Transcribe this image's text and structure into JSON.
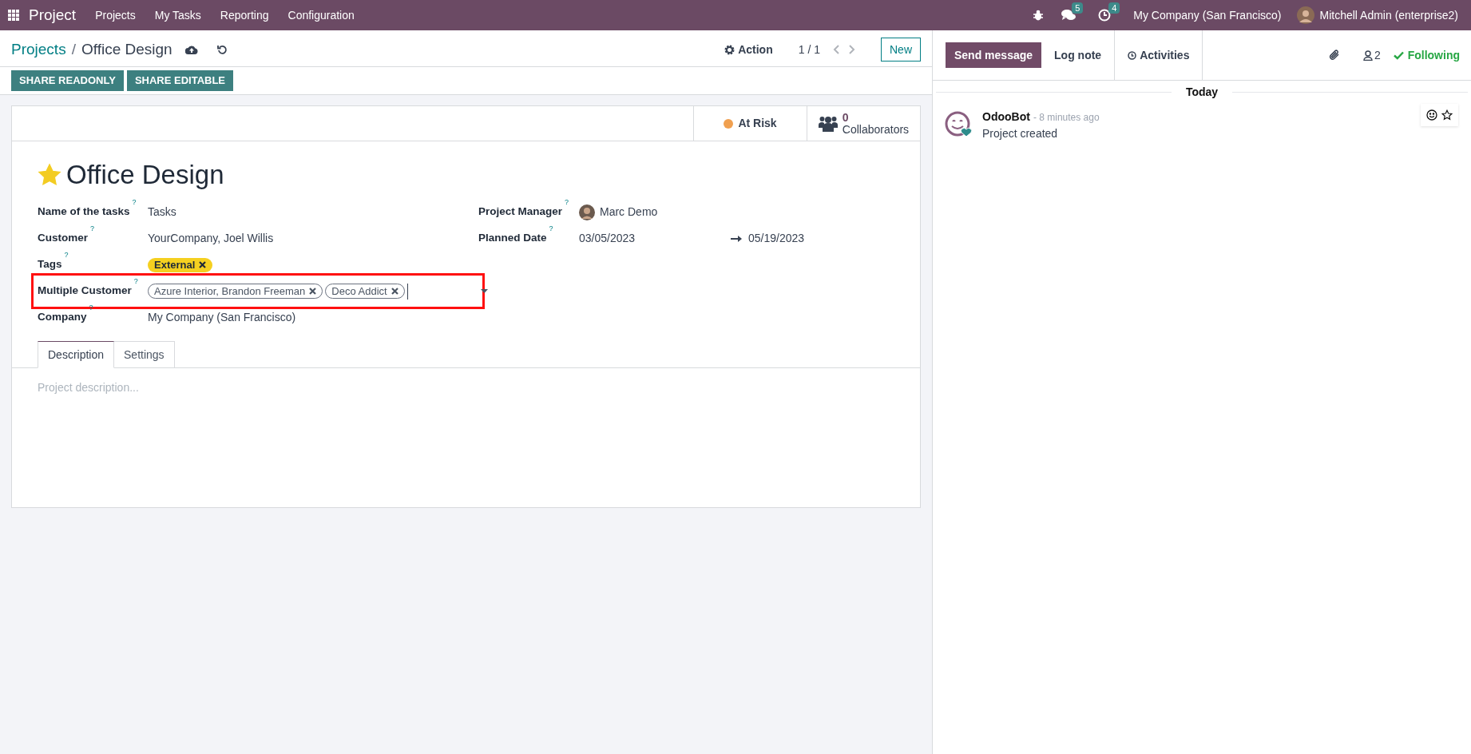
{
  "navbar": {
    "app": "Project",
    "menu": [
      "Projects",
      "My Tasks",
      "Reporting",
      "Configuration"
    ],
    "messages_count": "5",
    "activities_count": "4",
    "company": "My Company (San Francisco)",
    "user": "Mitchell Admin (enterprise2)"
  },
  "breadcrumb": {
    "parent": "Projects",
    "separator": "/",
    "current": "Office Design"
  },
  "help_mark": "?",
  "control": {
    "action": "Action",
    "pager": "1 / 1",
    "new_button": "New"
  },
  "share_buttons": [
    "SHARE READONLY",
    "SHARE EDITABLE"
  ],
  "stat_buttons": [
    {
      "kind": "status",
      "label": "At Risk",
      "color": "#f0a050"
    },
    {
      "kind": "count",
      "value": "0",
      "label": "Collaborators"
    }
  ],
  "record": {
    "title": "Office Design",
    "favorite": true
  },
  "left_fields": [
    {
      "label": "Name of the tasks",
      "kind": "text",
      "value": "Tasks",
      "highlighted": false
    },
    {
      "label": "Customer",
      "kind": "text",
      "value": "YourCompany, Joel Willis",
      "highlighted": false
    },
    {
      "label": "Tags",
      "kind": "tags",
      "tags": [
        {
          "text": "External",
          "color": "#f5d020"
        }
      ],
      "highlighted": false
    },
    {
      "label": "Multiple Customer",
      "kind": "many2many",
      "tags": [
        {
          "text": "Azure Interior, Brandon Freeman"
        },
        {
          "text": "Deco Addict"
        }
      ],
      "highlighted": true
    },
    {
      "label": "Company",
      "kind": "text",
      "value": "My Company (San Francisco)",
      "highlighted": false
    }
  ],
  "right_fields": [
    {
      "label": "Project Manager",
      "kind": "user",
      "value": "Marc Demo"
    },
    {
      "label": "Planned Date",
      "kind": "daterange",
      "start": "03/05/2023",
      "end": "05/19/2023"
    }
  ],
  "tabs": [
    {
      "label": "Description",
      "selected": true
    },
    {
      "label": "Settings",
      "selected": false
    }
  ],
  "description": {
    "placeholder": "Project description..."
  },
  "chatter": {
    "buttons": [
      {
        "label": "Send message",
        "selected": true
      },
      {
        "label": "Log note",
        "selected": false
      },
      {
        "label": "Activities",
        "selected": false
      }
    ],
    "followers": "2",
    "following": "Following",
    "day": "Today",
    "messages": [
      {
        "author": "OdooBot",
        "time": "- 8 minutes ago",
        "body": "Project created"
      }
    ]
  }
}
